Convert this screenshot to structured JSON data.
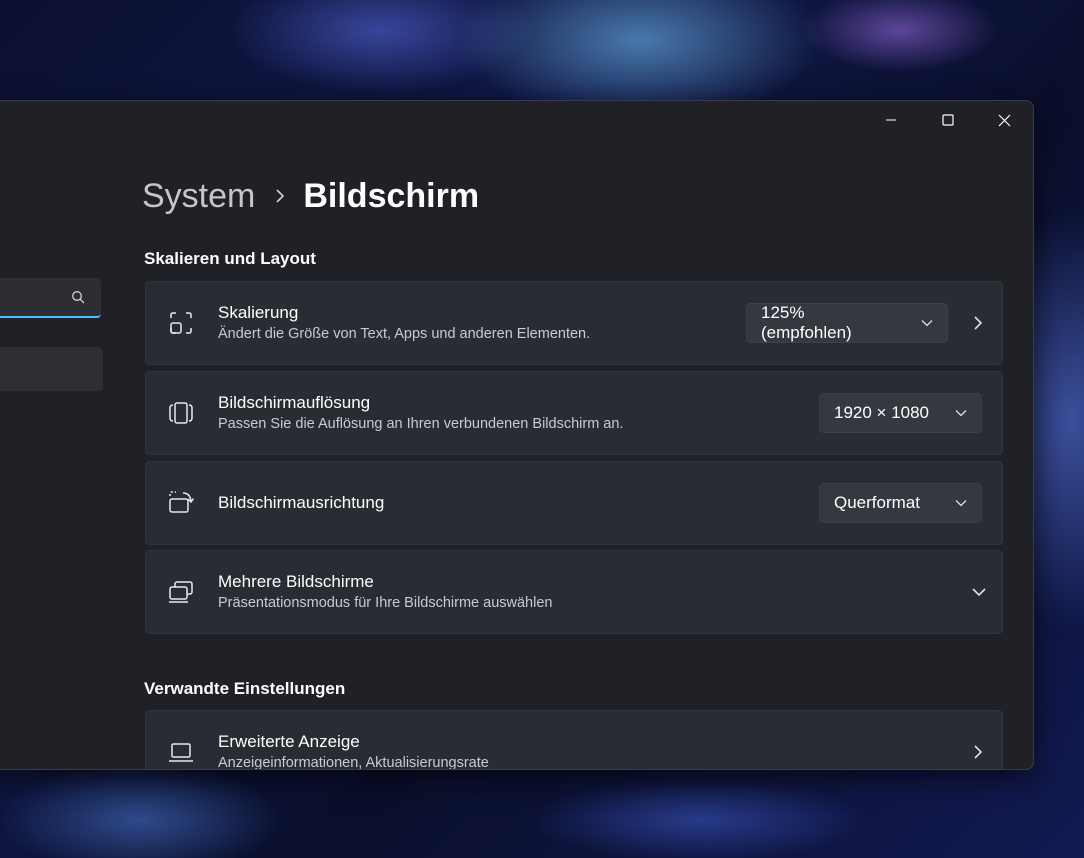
{
  "breadcrumb": {
    "parent": "System",
    "current": "Bildschirm"
  },
  "search": {
    "placeholder": ""
  },
  "sections": {
    "scale_layout": "Skalieren und Layout",
    "related": "Verwandte Einstellungen"
  },
  "settings": {
    "scaling": {
      "title": "Skalierung",
      "desc": "Ändert die Größe von Text, Apps und anderen Elementen.",
      "value": "125% (empfohlen)"
    },
    "resolution": {
      "title": "Bildschirmauflösung",
      "desc": "Passen Sie die Auflösung an Ihren verbundenen Bildschirm an.",
      "value": "1920 × 1080"
    },
    "orientation": {
      "title": "Bildschirmausrichtung",
      "value": "Querformat"
    },
    "multiple": {
      "title": "Mehrere Bildschirme",
      "desc": "Präsentationsmodus für Ihre Bildschirme auswählen"
    },
    "advanced": {
      "title": "Erweiterte Anzeige",
      "desc": "Anzeigeinformationen, Aktualisierungsrate"
    }
  },
  "icons": {
    "minimize": "minimize-icon",
    "maximize": "maximize-icon",
    "close": "close-icon",
    "search": "search-icon",
    "scaling": "scaling-icon",
    "resolution": "resolution-icon",
    "orientation": "orientation-icon",
    "multiple": "multiple-displays-icon",
    "advanced": "laptop-icon"
  },
  "colors": {
    "accent": "#4cc2ff",
    "window_bg": "#1f2127",
    "card_bg": "#2a2c33"
  }
}
